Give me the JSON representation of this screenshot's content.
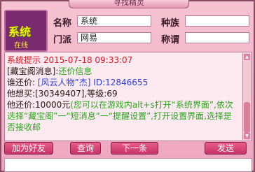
{
  "window": {
    "title": "寻找精灵"
  },
  "avatar": {
    "text": "系统",
    "status": "在线"
  },
  "profile": {
    "name_label": "名称",
    "name_value": "系统",
    "race_label": "种族",
    "race_value": "",
    "faction_label": "门派",
    "faction_value": "网易",
    "title_label": "称谓",
    "title_value": ""
  },
  "message": {
    "header": "系统提示",
    "timestamp": "2015-07-18 09:33:07",
    "line1_prefix": "[藏宝阁消息]:",
    "line1_highlight": "还价信息",
    "line2_prefix": "谁还价:",
    "line2_link": "[风云人物”杰]",
    "line2_id": "ID:12846655",
    "line3": "他想买:[30349407],等级:69",
    "line4_prefix": "他还价:10000元",
    "line4_tail": "(您可以在游戏内alt+s打开“系统界面”,依次选择“藏宝阁”一“短消息”一“提醒设置”,打开设置界面,选择是否接收邮"
  },
  "buttons": {
    "add_friend": "加为好友",
    "query": "查询",
    "next": "下一条",
    "send": "发送"
  }
}
